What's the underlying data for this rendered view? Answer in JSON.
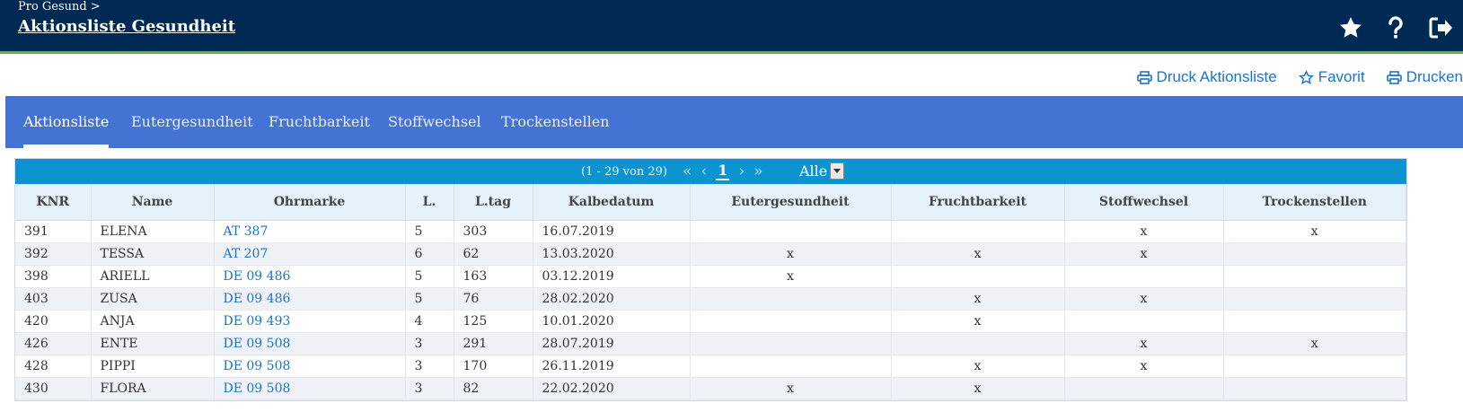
{
  "header": {
    "breadcrumb": "Pro Gesund >",
    "title": "Aktionsliste Gesundheit"
  },
  "actions": {
    "druck_aktionsliste": "Druck Aktionsliste",
    "favorit": "Favorit",
    "drucken": "Drucken"
  },
  "tabs": [
    {
      "label": "Aktionsliste"
    },
    {
      "label": "Eutergesundheit"
    },
    {
      "label": "Fruchtbarkeit"
    },
    {
      "label": "Stoffwechsel"
    },
    {
      "label": "Trockenstellen"
    }
  ],
  "pager": {
    "range": "(1 - 29 von 29)",
    "current_page": "1",
    "page_size": "Alle"
  },
  "table": {
    "columns": [
      "KNR",
      "Name",
      "Ohrmarke",
      "L.",
      "L.tag",
      "Kalbedatum",
      "Eutergesundheit",
      "Fruchtbarkeit",
      "Stoffwechsel",
      "Trockenstellen"
    ],
    "rows": [
      [
        "391",
        "ELENA",
        "AT 387",
        "5",
        "303",
        "16.07.2019",
        "",
        "",
        "x",
        "x"
      ],
      [
        "392",
        "TESSA",
        "AT 207",
        "6",
        "62",
        "13.03.2020",
        "x",
        "x",
        "x",
        ""
      ],
      [
        "398",
        "ARIELL",
        "DE 09 486",
        "5",
        "163",
        "03.12.2019",
        "x",
        "",
        "",
        ""
      ],
      [
        "403",
        "ZUSA",
        "DE 09 486",
        "5",
        "76",
        "28.02.2020",
        "",
        "x",
        "x",
        ""
      ],
      [
        "420",
        "ANJA",
        "DE 09 493",
        "4",
        "125",
        "10.01.2020",
        "",
        "x",
        "",
        ""
      ],
      [
        "426",
        "ENTE",
        "DE 09 508",
        "3",
        "291",
        "28.07.2019",
        "",
        "",
        "x",
        "x"
      ],
      [
        "428",
        "PIPPI",
        "DE 09 508",
        "3",
        "170",
        "26.11.2019",
        "",
        "x",
        "x",
        ""
      ],
      [
        "430",
        "FLORA",
        "DE 09 508",
        "3",
        "82",
        "22.02.2020",
        "x",
        "x",
        "",
        ""
      ]
    ]
  }
}
